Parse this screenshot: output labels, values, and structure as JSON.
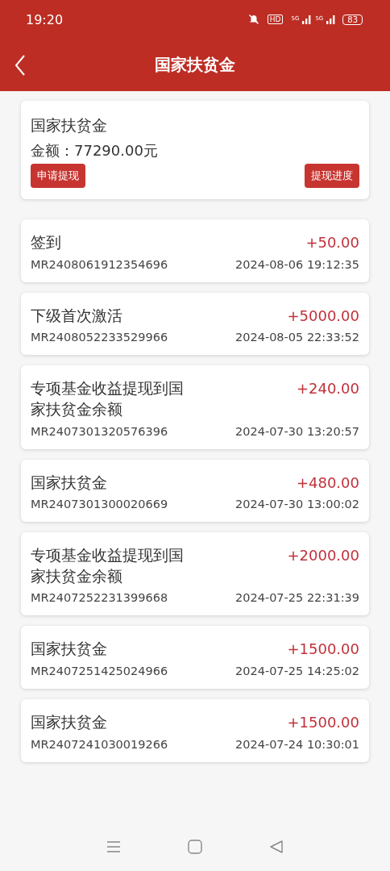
{
  "status_bar": {
    "time": "19:20",
    "hd": "HD",
    "signal_1": "5G",
    "signal_2": "5G",
    "battery": "83"
  },
  "header": {
    "title": "国家扶贫金"
  },
  "summary": {
    "title": "国家扶贫金",
    "amount": "金额：77290.00元",
    "buttons": [
      "申请提现",
      "提现进度"
    ]
  },
  "records": [
    {
      "title": "签到",
      "amount": "+50.00",
      "id": "MR2408061912354696",
      "time": "2024-08-06 19:12:35"
    },
    {
      "title": "下级首次激活",
      "amount": "+5000.00",
      "id": "MR2408052233529966",
      "time": "2024-08-05 22:33:52"
    },
    {
      "title": "专项基金收益提现到国家扶贫金余额",
      "amount": "+240.00",
      "id": "MR2407301320576396",
      "time": "2024-07-30 13:20:57"
    },
    {
      "title": "国家扶贫金",
      "amount": "+480.00",
      "id": "MR2407301300020669",
      "time": "2024-07-30 13:00:02"
    },
    {
      "title": "专项基金收益提现到国家扶贫金余额",
      "amount": "+2000.00",
      "id": "MR2407252231399668",
      "time": "2024-07-25 22:31:39"
    },
    {
      "title": "国家扶贫金",
      "amount": "+1500.00",
      "id": "MR2407251425024966",
      "time": "2024-07-25 14:25:02"
    },
    {
      "title": "国家扶贫金",
      "amount": "+1500.00",
      "id": "MR2407241030019266",
      "time": "2024-07-24 10:30:01"
    }
  ]
}
